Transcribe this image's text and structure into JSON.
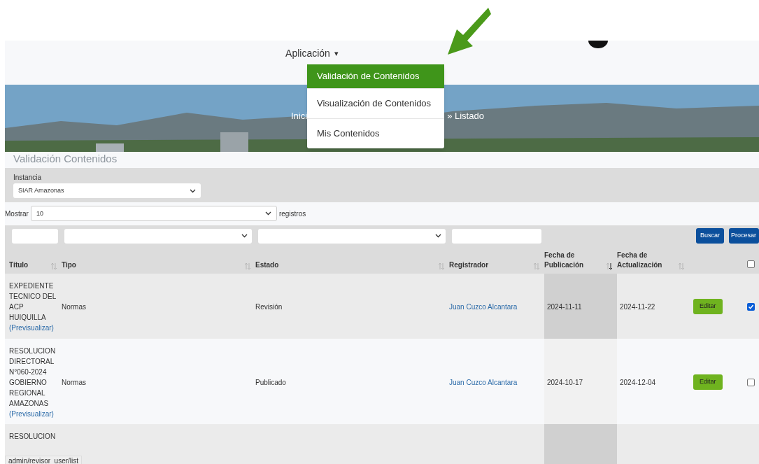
{
  "navbar": {
    "menu_label": "Aplicación",
    "menu_caret": "▾",
    "menu_expanded": true
  },
  "dropdown": [
    {
      "label": "Validación de Contenidos",
      "selected": true
    },
    {
      "label": "Visualización de Contenidos",
      "selected": false
    },
    {
      "label": "Mis Contenidos",
      "selected": false
    }
  ],
  "breadcrumb": {
    "first": "Inici",
    "separator": "»",
    "current": "Listado"
  },
  "page_title": "Validación Contenidos",
  "instance": {
    "label": "Instancia",
    "value": "SIAR Amazonas"
  },
  "page_length": {
    "before": "Mostrar",
    "value": "10",
    "after": "registros"
  },
  "buttons": [
    "Buscar",
    "Procesar"
  ],
  "columns": [
    {
      "label": "Título",
      "sorted": false
    },
    {
      "label": "Tipo",
      "sorted": false
    },
    {
      "label": "Estado",
      "sorted": false
    },
    {
      "label": "Registrador",
      "sorted": false
    },
    {
      "label": "Fecha de Publicación",
      "sorted": true
    },
    {
      "label": "Fecha de Actualización",
      "sorted": false
    }
  ],
  "select_all_checked": false,
  "rows": [
    {
      "title": "EXPEDIENTE TECNICO DEL ACP HUIQUILLA",
      "preview": "(Previsualizar)",
      "type": "Normas",
      "status": "Revisión",
      "registrar": "Juan Cuzco Alcantara",
      "published": "2024-11-11",
      "updated": "2024-11-22",
      "action": "Editar",
      "checked": true
    },
    {
      "title": "RESOLUCION DIRECTORAL N°060-2024 GOBIERNO REGIONAL AMAZONAS",
      "preview": "(Previsualizar)",
      "type": "Normas",
      "status": "Publicado",
      "registrar": "Juan Cuzco Alcantara",
      "published": "2024-10-17",
      "updated": "2024-12-04",
      "action": "Editar",
      "checked": false
    },
    {
      "title": "RESOLUCION"
    }
  ],
  "status_url": "admin/revisor_user/list"
}
